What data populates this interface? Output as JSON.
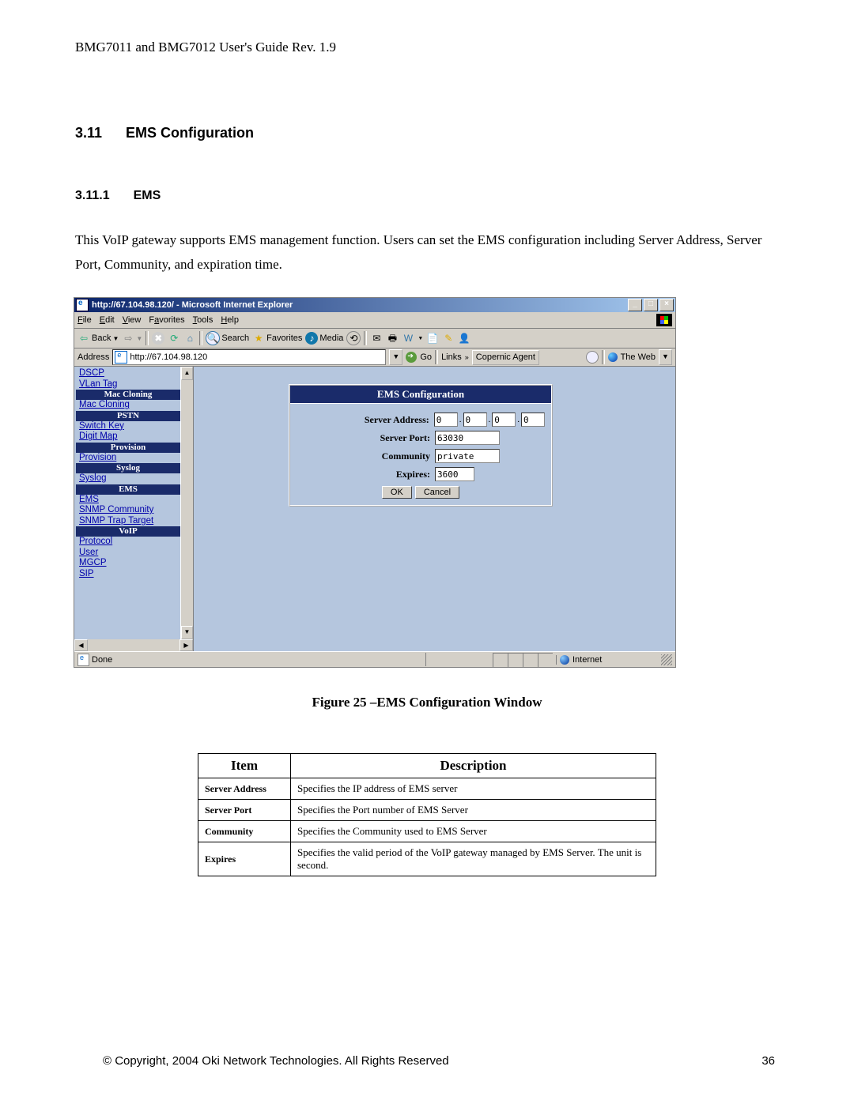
{
  "page_header": "BMG7011 and BMG7012 User's Guide Rev. 1.9",
  "section": {
    "num": "3.11",
    "title": "EMS Configuration"
  },
  "subsection": {
    "num": "3.11.1",
    "title": "EMS"
  },
  "paragraph": "This VoIP gateway supports EMS management function. Users can set the EMS configuration including Server Address, Server Port, Community, and expiration time.",
  "figure_caption": "Figure 25 –EMS Configuration Window",
  "browser": {
    "title": "http://67.104.98.120/ - Microsoft Internet Explorer",
    "win_min": "_",
    "win_max": "□",
    "win_close": "×",
    "menu": {
      "file": "File",
      "edit": "Edit",
      "view": "View",
      "favorites": "Favorites",
      "tools": "Tools",
      "help": "Help"
    },
    "toolbar": {
      "back": "Back",
      "search": "Search",
      "favorites": "Favorites",
      "media": "Media"
    },
    "address_label": "Address",
    "address_value": "http://67.104.98.120",
    "go": "Go",
    "links": "Links",
    "copernic": "Copernic Agent",
    "the_web": "The Web",
    "status_done": "Done",
    "status_zone": "Internet"
  },
  "sidebar": {
    "links1": [
      "DSCP",
      "VLan Tag"
    ],
    "group_mac": "Mac Cloning",
    "links_mac": [
      "Mac Cloning"
    ],
    "group_pstn": "PSTN",
    "links_pstn": [
      "Switch Key",
      "Digit Map"
    ],
    "group_prov": "Provision",
    "links_prov": [
      "Provision"
    ],
    "group_syslog": "Syslog",
    "links_syslog": [
      "Syslog"
    ],
    "group_ems": "EMS",
    "links_ems": [
      "EMS",
      "SNMP Community",
      "SNMP Trap Target"
    ],
    "group_voip": "VoIP",
    "links_voip": [
      "Protocol",
      "User",
      "MGCP",
      "SIP"
    ]
  },
  "panel": {
    "title": "EMS Configuration",
    "server_address_label": "Server Address:",
    "server_port_label": "Server Port:",
    "community_label": "Community",
    "expires_label": "Expires:",
    "ip": [
      "0",
      "0",
      "0",
      "0"
    ],
    "port": "63030",
    "community": "private",
    "expires": "3600",
    "ok": "OK",
    "cancel": "Cancel"
  },
  "table": {
    "head_item": "Item",
    "head_desc": "Description",
    "rows": [
      {
        "item": "Server Address",
        "desc": "Specifies the IP address of EMS server"
      },
      {
        "item": "Server Port",
        "desc": "Specifies the Port number of EMS Server"
      },
      {
        "item": "Community",
        "desc": "Specifies the Community used to EMS Server"
      },
      {
        "item": "Expires",
        "desc": "Specifies the valid period of the VoIP gateway managed by EMS Server. The unit is second."
      }
    ]
  },
  "footer": {
    "copyright": "© Copyright, 2004 Oki Network Technologies. All Rights Reserved",
    "page": "36"
  }
}
